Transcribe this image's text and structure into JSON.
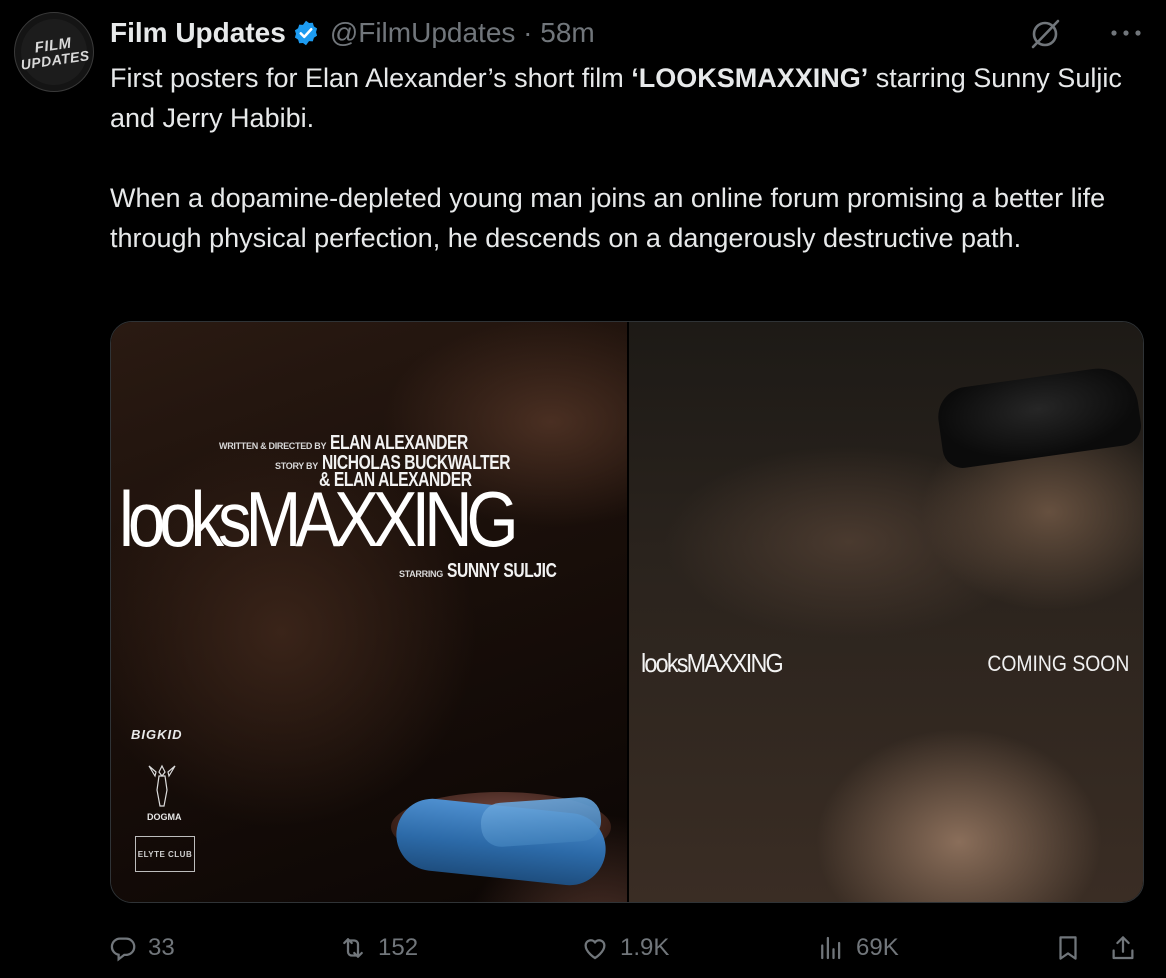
{
  "author": {
    "avatar_lines": [
      "FILM",
      "UPDATES"
    ],
    "name": "Film Updates",
    "handle_time": "@FilmUpdates · 58m"
  },
  "tweet": {
    "text_before": "First posters for Elan Alexander’s short film ",
    "title_strong": "‘LOOKSMAXXING’",
    "text_after": " starring Sunny Suljic and Jerry Habibi.",
    "paragraph2": "When a dopamine-depleted young man joins an online forum promising a better life through physical perfection, he descends on a dangerously destructive path."
  },
  "poster_left": {
    "credit1_small": "WRITTEN & DIRECTED BY",
    "credit1_big": "ELAN ALEXANDER",
    "credit2_small": "STORY BY",
    "credit2_big": "NICHOLAS BUCKWALTER",
    "credit3_big": "& ELAN ALEXANDER",
    "title": "looksMAXXING",
    "starring_small": "STARRING",
    "starring_big": "SUNNY SULJIC",
    "logo1": "BIGKID",
    "logo2": "DOGMA",
    "logo3": "ELYTE CLUB"
  },
  "poster_right": {
    "title": "looksMAXXING",
    "tagline": "COMING SOON"
  },
  "actions": {
    "replies": "33",
    "reposts": "152",
    "likes": "1.9K",
    "views": "69K"
  },
  "colors": {
    "background": "#000000",
    "text": "#e7e9ea",
    "muted": "#71767b",
    "verified": "#1d9bf0"
  }
}
